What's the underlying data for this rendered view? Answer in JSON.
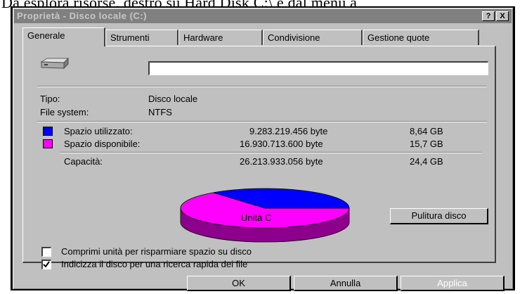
{
  "caption": "Da esplora risorse, destro su Hard Disk C:\\ e dal menù a",
  "window": {
    "title": "Proprietà - Disco locale (C:)",
    "help_button": "?",
    "close_button": "X"
  },
  "tabs": [
    "Generale",
    "Strumenti",
    "Hardware",
    "Condivisione",
    "Gestione quote"
  ],
  "general": {
    "name_value": "",
    "type_label": "Tipo:",
    "type_value": "Disco locale",
    "fs_label": "File system:",
    "fs_value": "NTFS",
    "used": {
      "label": "Spazio utilizzato:",
      "bytes": "9.283.219.456 byte",
      "size": "8,64 GB",
      "color": "#0000ff"
    },
    "free": {
      "label": "Spazio disponibile:",
      "bytes": "16.930.713.600 byte",
      "size": "15,7 GB",
      "color": "#ff00ff"
    },
    "capacity": {
      "label": "Capacità:",
      "bytes": "26.213.933.056 byte",
      "size": "24,4 GB"
    },
    "drive_label": "Unità C",
    "cleanup_button": "Pulitura disco",
    "compress_label": "Comprimi unità per risparmiare spazio su disco",
    "compress_checked": false,
    "index_label": "Indicizza il disco per una ricerca rapida dei file",
    "index_checked": true
  },
  "chart_data": {
    "type": "pie",
    "categories": [
      "Spazio utilizzato",
      "Spazio disponibile"
    ],
    "values": [
      8.64,
      15.7
    ],
    "colors": [
      "#0000ff",
      "#ff00ff"
    ]
  },
  "buttons": {
    "ok": "OK",
    "cancel": "Annulla",
    "apply": "Applica"
  }
}
